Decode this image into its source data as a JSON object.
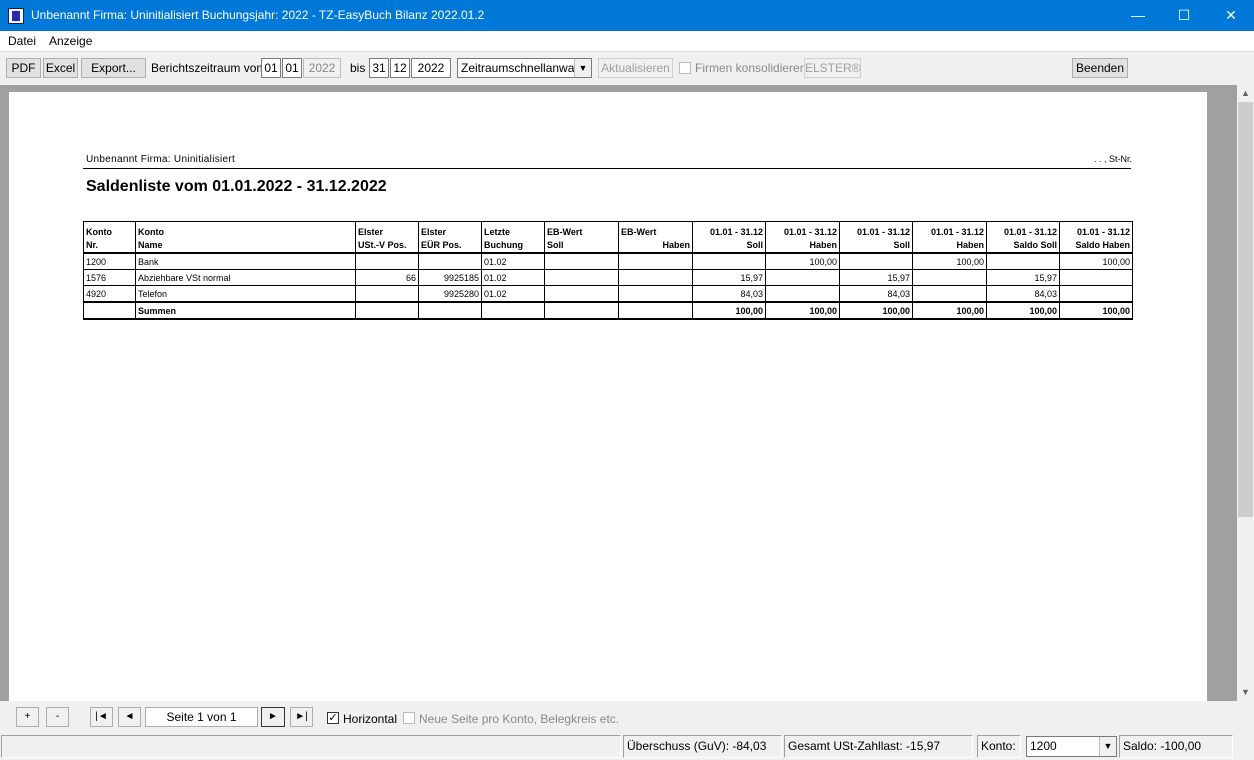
{
  "window": {
    "title": "Unbenannt   Firma: Uninitialisiert   Buchungsjahr: 2022 - TZ-EasyBuch Bilanz 2022.01.2",
    "minimize_glyph": "—",
    "maximize_glyph": "☐",
    "close_glyph": "✕"
  },
  "menu": [
    "Datei",
    "Anzeige"
  ],
  "toolbar": {
    "pdf": "PDF",
    "excel": "Excel",
    "export": "Export...",
    "period_label": "Berichtszeitraum vom",
    "from_day": "01",
    "from_month": "01",
    "from_year": "2022",
    "to_label": "bis",
    "to_day": "31",
    "to_month": "12",
    "to_year": "2022",
    "quick_select": "Zeitraumschnellanwahl",
    "refresh": "Aktualisieren",
    "consolidate": "Firmen konsolidieren",
    "elster": "ELSTER®",
    "quit": "Beenden"
  },
  "report": {
    "header_left": "Unbenannt   Firma: Uninitialisiert",
    "header_right": ". . , St-Nr.",
    "title": "Saldenliste vom 01.01.2022 - 31.12.2022",
    "header_row1": [
      "Konto",
      "Konto",
      "Elster",
      "Elster",
      "Letzte",
      "EB-Wert",
      "EB-Wert",
      "01.01 - 31.12",
      "01.01 - 31.12",
      "01.01 - 31.12",
      "01.01 - 31.12",
      "01.01 - 31.12",
      "01.01 - 31.12"
    ],
    "header_row2": [
      "Nr.",
      "Name",
      "USt.-V Pos.",
      "EÜR Pos.",
      "Buchung",
      "Soll",
      "Haben",
      "Soll",
      "Haben",
      "Soll",
      "Haben",
      "Saldo Soll",
      "Saldo Haben"
    ],
    "rows": [
      [
        "1200",
        "Bank",
        "",
        "",
        "01.02",
        "",
        "",
        "",
        "100,00",
        "",
        "100,00",
        "",
        "100,00"
      ],
      [
        "1576",
        "Abziehbare VSt normal",
        "66",
        "9925185",
        "01.02",
        "",
        "",
        "15,97",
        "",
        "15,97",
        "",
        "15,97",
        ""
      ],
      [
        "4920",
        "Telefon",
        "",
        "9925280",
        "01.02",
        "",
        "",
        "84,03",
        "",
        "84,03",
        "",
        "84,03",
        ""
      ]
    ],
    "sum_row": [
      "",
      "Summen",
      "",
      "",
      "",
      "",
      "",
      "100,00",
      "100,00",
      "100,00",
      "100,00",
      "100,00",
      "100,00"
    ]
  },
  "nav": {
    "zoom_in": "+",
    "zoom_out": "-",
    "first": "|◄",
    "prev": "◄",
    "page": "Seite 1 von 1",
    "next": "►",
    "last": "►|",
    "horizontal": "Horizontal",
    "horizontal_checked": "✓",
    "new_page": "Neue Seite pro Konto, Belegkreis etc."
  },
  "status": {
    "surplus": "Überschuss (GuV): -84,03",
    "vat": "Gesamt USt-Zahllast: -15,97",
    "konto_label": "Konto:",
    "konto_value": "1200",
    "saldo": "Saldo: -100,00"
  }
}
